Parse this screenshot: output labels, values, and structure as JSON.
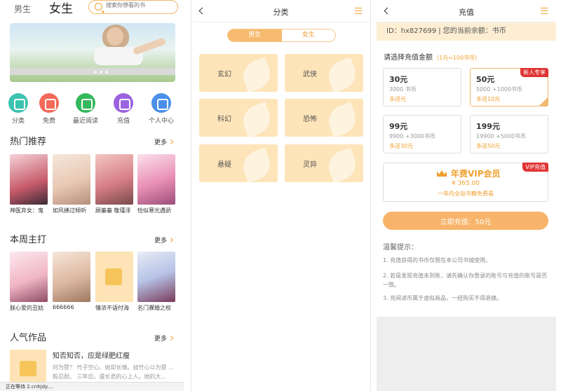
{
  "home": {
    "tab_male": "男生",
    "tab_female": "女生",
    "search_placeholder": "搜索你想看的书",
    "quick_links": [
      "分类",
      "免费",
      "最近阅读",
      "充值",
      "个人中心"
    ],
    "sections": {
      "hot": {
        "title": "热门推荐",
        "more": "更多"
      },
      "weekly": {
        "title": "本周主打",
        "more": "更多"
      },
      "popular": {
        "title": "人气作品",
        "more": "更多"
      }
    },
    "hot_books": [
      "神医弃女：鬼",
      "如风拂过倾听",
      "顾蓁蓁 敬瑾泽",
      "恰似寒光遇骄"
    ],
    "weekly_books": [
      "朕心爱的丑姑",
      "666666",
      "情浓不语付海",
      "名门骤婚之权"
    ],
    "popular_item": {
      "title": "知否知否，应是绿肥红瘦",
      "desc": "何为赞？ 竹子空心、她却长情。叔竹心以为赞 ... 毅忍耐。 三年后，虞长君的心上人。她的大..."
    },
    "status": "正在等待 2.cnhjdy...."
  },
  "category": {
    "title": "分类",
    "seg_male": "男生",
    "seg_female": "女生",
    "items": [
      "玄幻",
      "武侠",
      "科幻",
      "恐怖",
      "悬疑",
      "灵异"
    ]
  },
  "recharge": {
    "title": "充值",
    "account": "ID：hx827699  |  您的当前余额：书币",
    "choose_label": "请选择充值金额",
    "rate": "(1元=100书币)",
    "packages": [
      {
        "amount": "30元",
        "coins": "3000 书币",
        "bonus": "多送元",
        "badge": ""
      },
      {
        "amount": "50元",
        "coins": "5000 +1000书币",
        "bonus": "多送10元",
        "badge": "新人专享"
      },
      {
        "amount": "99元",
        "coins": "9900 +3000书币",
        "bonus": "多送30元",
        "badge": ""
      },
      {
        "amount": "199元",
        "coins": "19900 +5000书币",
        "bonus": "多送50元",
        "badge": ""
      }
    ],
    "vip": {
      "title": "年费VIP会员",
      "price": "¥ 365.00",
      "desc": "一年内全站书籍免费看",
      "badge": "VIP充值"
    },
    "pay_button": "立即充值：50元",
    "tips_title": "温馨提示：",
    "tips": [
      "1. 充值获得的书币仅限在本公司书城使用。",
      "2. 若是发现充值未到账，请先确认你登录的账号与充值的账号是否一致。",
      "3. 充阅读币属于虚拟商品，一经购买不得退换。"
    ]
  },
  "colors": {
    "accent": "#f0a030",
    "accent_light": "#fde4b9",
    "badge_red": "#e03434",
    "quick_icons": [
      "#3cc2b0",
      "#f36a5a",
      "#35b85c",
      "#9b63e0",
      "#4a90e8"
    ]
  }
}
